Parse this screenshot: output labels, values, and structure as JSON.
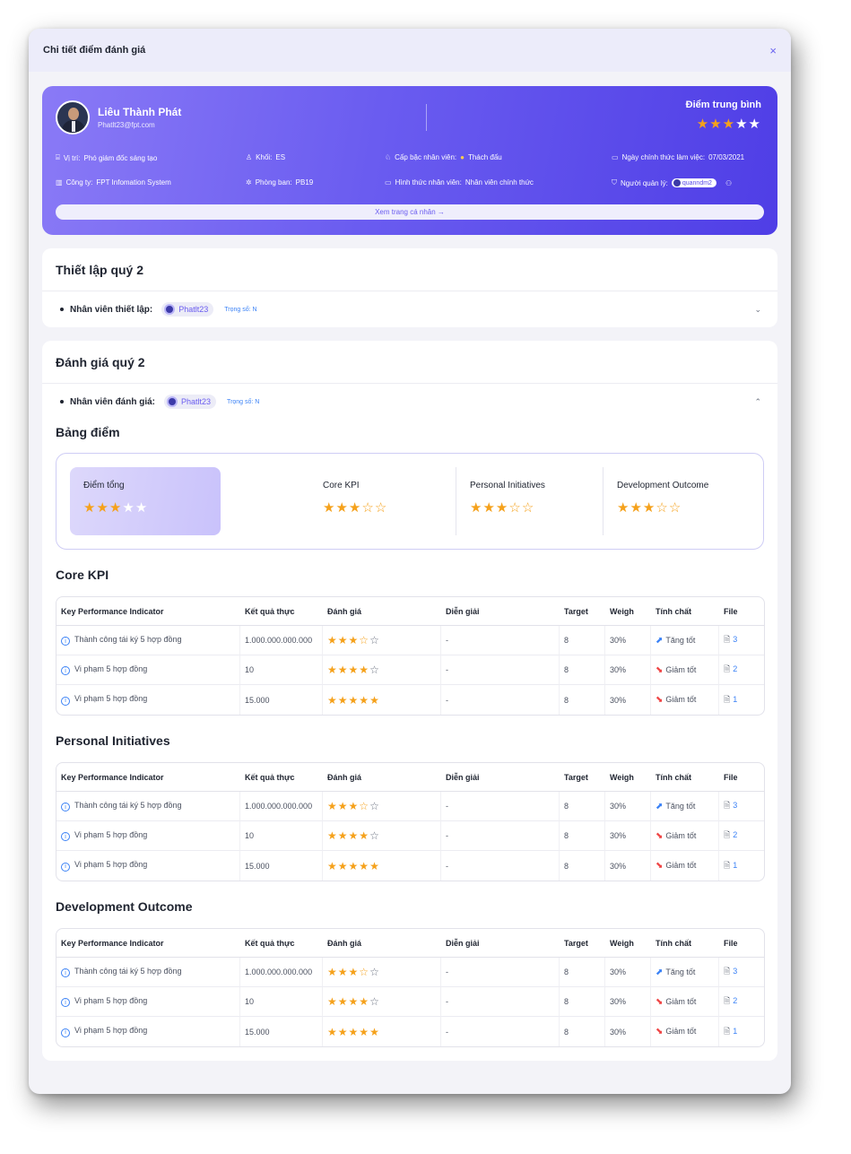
{
  "modal": {
    "title": "Chi tiết điểm đánh giá",
    "close": "×"
  },
  "profile": {
    "name": "Liêu Thành Phát",
    "email": "Phatlt23@fpt.com",
    "avg_label": "Điểm trung bình",
    "avg_stars": [
      "on",
      "on",
      "on",
      "white",
      "white"
    ],
    "position_label": "Vị trí:",
    "position": "Phó giám đốc sáng tạo",
    "block_label": "Khối:",
    "block": "ES",
    "rank_label": "Cấp bậc nhân viên:",
    "rank": "Thách đấu",
    "start_label": "Ngày chính thức làm việc:",
    "start": "07/03/2021",
    "company_label": "Công ty:",
    "company": "FPT Infomation System",
    "dept_label": "Phòng ban:",
    "dept": "PB19",
    "type_label": "Hình thức nhân viên:",
    "type": "Nhân viên chính thức",
    "manager_label": "Người quản lý:",
    "manager": "quanndm2",
    "view_profile": "Xem trang cá nhân →"
  },
  "setup": {
    "title": "Thiết lập quý 2",
    "assignee_label": "Nhân viên thiết lập:",
    "assignee": "Phatlt23",
    "weight": "Trọng số: N",
    "chevron": "⌄"
  },
  "evaluation": {
    "title": "Đánh giá quý 2",
    "assignee_label": "Nhân viên đánh giá:",
    "assignee": "Phatlt23",
    "weight": "Trọng số: N",
    "chevron": "⌃",
    "scoreboard_title": "Bảng điểm",
    "summary": {
      "total": {
        "label": "Điểm tổng",
        "stars": [
          "on",
          "on",
          "on",
          "white",
          "white"
        ]
      },
      "items": [
        {
          "label": "Core KPI",
          "stars": [
            "on",
            "on",
            "on",
            "off",
            "off"
          ]
        },
        {
          "label": "Personal Initiatives",
          "stars": [
            "on",
            "on",
            "on",
            "off",
            "off"
          ]
        },
        {
          "label": "Development Outcome",
          "stars": [
            "on",
            "on",
            "on",
            "off",
            "off"
          ]
        }
      ]
    }
  },
  "table_headers": [
    "Key Performance Indicator",
    "Kết quả thực",
    "Đánh giá",
    "Diễn giải",
    "Target",
    "Weigh",
    "Tính chất",
    "File"
  ],
  "tables": [
    {
      "title": "Core KPI",
      "rows": [
        {
          "kpi": "Thành công tái ký 5 hợp đồng",
          "result": "1.000.000.000.000",
          "stars": [
            "on",
            "on",
            "on",
            "off",
            "gray"
          ],
          "note": "-",
          "target": "8",
          "weigh": "30%",
          "trend": "up",
          "trend_label": "Tăng tốt",
          "files": "3"
        },
        {
          "kpi": "Vi phạm 5 hợp đồng",
          "result": "10",
          "stars": [
            "on",
            "on",
            "on",
            "on",
            "gray"
          ],
          "note": "-",
          "target": "8",
          "weigh": "30%",
          "trend": "down",
          "trend_label": "Giảm tốt",
          "files": "2"
        },
        {
          "kpi": "Vi phạm 5 hợp đồng",
          "result": "15.000",
          "stars": [
            "on",
            "on",
            "on",
            "on",
            "on"
          ],
          "note": "-",
          "target": "8",
          "weigh": "30%",
          "trend": "down",
          "trend_label": "Giảm tốt",
          "files": "1"
        }
      ]
    },
    {
      "title": "Personal Initiatives",
      "rows": [
        {
          "kpi": "Thành công tái ký 5 hợp đồng",
          "result": "1.000.000.000.000",
          "stars": [
            "on",
            "on",
            "on",
            "off",
            "gray"
          ],
          "note": "-",
          "target": "8",
          "weigh": "30%",
          "trend": "up",
          "trend_label": "Tăng tốt",
          "files": "3"
        },
        {
          "kpi": "Vi phạm 5 hợp đồng",
          "result": "10",
          "stars": [
            "on",
            "on",
            "on",
            "on",
            "gray"
          ],
          "note": "-",
          "target": "8",
          "weigh": "30%",
          "trend": "down",
          "trend_label": "Giảm tốt",
          "files": "2"
        },
        {
          "kpi": "Vi phạm 5 hợp đồng",
          "result": "15.000",
          "stars": [
            "on",
            "on",
            "on",
            "on",
            "on"
          ],
          "note": "-",
          "target": "8",
          "weigh": "30%",
          "trend": "down",
          "trend_label": "Giảm tốt",
          "files": "1"
        }
      ]
    },
    {
      "title": "Development Outcome",
      "rows": [
        {
          "kpi": "Thành công tái ký 5 hợp đồng",
          "result": "1.000.000.000.000",
          "stars": [
            "on",
            "on",
            "on",
            "off",
            "gray"
          ],
          "note": "-",
          "target": "8",
          "weigh": "30%",
          "trend": "up",
          "trend_label": "Tăng tốt",
          "files": "3"
        },
        {
          "kpi": "Vi phạm 5 hợp đồng",
          "result": "10",
          "stars": [
            "on",
            "on",
            "on",
            "on",
            "gray"
          ],
          "note": "-",
          "target": "8",
          "weigh": "30%",
          "trend": "down",
          "trend_label": "Giảm tốt",
          "files": "2"
        },
        {
          "kpi": "Vi phạm 5 hợp đồng",
          "result": "15.000",
          "stars": [
            "on",
            "on",
            "on",
            "on",
            "on"
          ],
          "note": "-",
          "target": "8",
          "weigh": "30%",
          "trend": "down",
          "trend_label": "Giảm tốt",
          "files": "1"
        }
      ]
    }
  ],
  "colors": {
    "accent": "#6a5cf0",
    "star": "#f5a11b",
    "link": "#3b82f6",
    "down": "#ef4444"
  }
}
